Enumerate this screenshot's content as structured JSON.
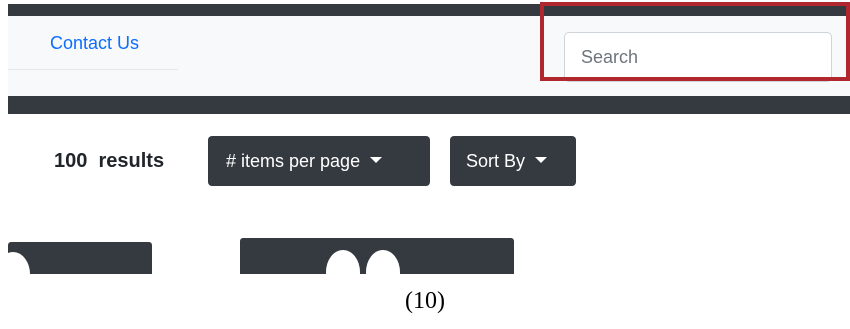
{
  "navbar": {
    "links": [
      {
        "label": "Contact Us"
      }
    ]
  },
  "search": {
    "placeholder": "Search",
    "value": ""
  },
  "results": {
    "count_text": "100  results"
  },
  "toolbar": {
    "items_per_page_label": "# items per page",
    "sort_by_label": "Sort By"
  },
  "caption": "(10)",
  "colors": {
    "dark": "#343a40",
    "navbar_bg": "#f8f9fa",
    "link": "#0d6efd",
    "highlight": "#b0282e"
  }
}
